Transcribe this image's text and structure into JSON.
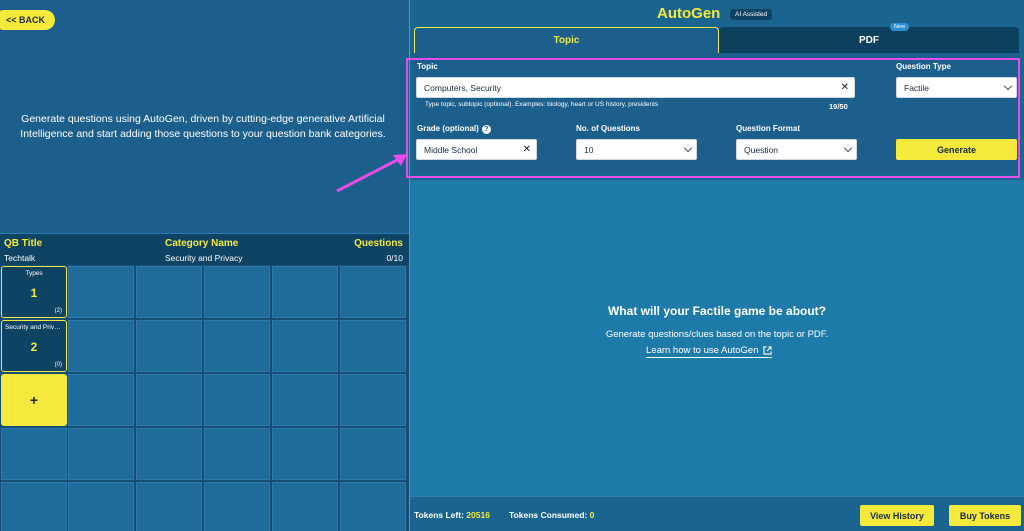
{
  "left": {
    "back_label": "<< BACK",
    "intro_text": "Generate questions using AutoGen, driven by cutting-edge generative Artificial Intelligence and start adding those questions to your question bank categories.",
    "table": {
      "headers": {
        "qb_title": "QB Title",
        "category_name": "Category Name",
        "questions": "Questions"
      },
      "row": {
        "qb_title": "Techtalk",
        "category_name": "Security and Privacy",
        "questions": "0/10"
      }
    },
    "categories": [
      {
        "title": "Types",
        "number": "1",
        "count": "(2)"
      },
      {
        "title": "Security and Priva...",
        "number": "2",
        "count": "(0)"
      }
    ],
    "add_label": "+"
  },
  "right": {
    "app_title": "AutoGen",
    "ai_badge": "AI Assisted",
    "tabs": [
      {
        "label": "Topic"
      },
      {
        "label": "PDF"
      }
    ],
    "pdf_badge": "New",
    "form": {
      "topic_label": "Topic",
      "topic_value": "Computers, Security",
      "topic_hint": "Type topic, subtopic (optional). Examples: biology, heart or US history, presidents",
      "topic_counter": "19/50",
      "question_type_label": "Question Type",
      "question_type_value": "Factile",
      "grade_label": "Grade (optional)",
      "grade_value": "Middle School",
      "num_questions_label": "No. of Questions",
      "num_questions_value": "10",
      "question_format_label": "Question Format",
      "question_format_value": "Question",
      "generate_label": "Generate",
      "clear_glyph": "✕",
      "info_glyph": "?"
    },
    "empty_state": {
      "title": "What will your Factile game be about?",
      "subtitle": "Generate questions/clues based on the topic or PDF.",
      "link": "Learn how to use AutoGen"
    },
    "footer": {
      "tokens_left_label": "Tokens Left:",
      "tokens_left_value": "20516",
      "tokens_consumed_label": "Tokens Consumed:",
      "tokens_consumed_value": "0",
      "view_history_label": "View History",
      "buy_tokens_label": "Buy Tokens"
    }
  },
  "colors": {
    "accent": "#f5e93c",
    "highlight": "#e84be8",
    "panel": "#1c5f8c"
  }
}
